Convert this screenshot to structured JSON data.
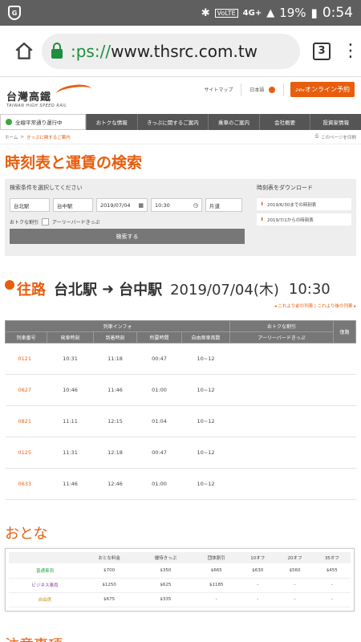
{
  "status_bar": {
    "shield_letter": "G",
    "signal": "4G+",
    "battery": "19%",
    "time": "0:54"
  },
  "browser": {
    "url_scheme": ":ps://",
    "url_rest": "www.thsrc.com.tw",
    "tab_count": "3"
  },
  "site": {
    "logo_main": "台灣高鐵",
    "logo_sub": "TAIWAN HIGH SPEED RAIL",
    "header_links": [
      "サイトマップ",
      "日本語"
    ],
    "online_badge": "24hr",
    "online_label": "オンライン予約",
    "status_label": "全線平常通り運行中",
    "nav": [
      "おトクな情報",
      "きっぷに関するご案内",
      "乗車のご案内",
      "会社概要",
      "投資家情報"
    ],
    "accent_color": "#e75e0e"
  },
  "breadcrumb": {
    "home": "ホーム",
    "separator": ">",
    "current": "きっぷに関するご案内",
    "print": "このページを印刷"
  },
  "page_title": "時刻表と運賃の検索",
  "search": {
    "label": "検索条件を選択してください",
    "from": "台北駅",
    "to": "台中駅",
    "date": "2019/07/04",
    "time": "10:30",
    "trip_type": "片道",
    "discount_label": "おトクな割引",
    "early_bird_label": "アーリーバードきっぷ",
    "search_button": "検索する",
    "download_label": "時刻表をダウンロード",
    "downloads": [
      "2019/6/30までの時刻表",
      "2019/7/1からの時刻表"
    ]
  },
  "route": {
    "type": "往路",
    "from": "台北駅",
    "to": "台中駅",
    "date": "2019/07/04(木)",
    "time": "10:30",
    "prev_link": "これより前の列車",
    "next_link": "これより後の列車",
    "sep": "|"
  },
  "train_table": {
    "group_headers": [
      "列車インフォ",
      "おトクな割引",
      "復路"
    ],
    "columns": [
      "列車番号",
      "発車時刻",
      "到着時刻",
      "所要時間",
      "自由席車両数",
      "アーリーバードきっぷ"
    ],
    "rows": [
      {
        "no": "0121",
        "dep": "10:31",
        "arr": "11:18",
        "dur": "00:47",
        "cars": "10~12"
      },
      {
        "no": "0627",
        "dep": "10:46",
        "arr": "11:46",
        "dur": "01:00",
        "cars": "10~12"
      },
      {
        "no": "0821",
        "dep": "11:11",
        "arr": "12:15",
        "dur": "01:04",
        "cars": "10~12"
      },
      {
        "no": "0125",
        "dep": "11:31",
        "arr": "12:18",
        "dur": "00:47",
        "cars": "10~12"
      },
      {
        "no": "0633",
        "dep": "11:46",
        "arr": "12:46",
        "dur": "01:00",
        "cars": "10~12"
      }
    ]
  },
  "fare": {
    "title": "おとな",
    "columns": [
      "",
      "おとな料金",
      "優待きっぷ",
      "団体割引",
      "10オフ",
      "20オフ",
      "35オフ"
    ],
    "rows": [
      {
        "cls": "普通車両",
        "color": "#2e9e4a",
        "vals": [
          "$700",
          "$350",
          "$665",
          "$630",
          "$560",
          "$455"
        ]
      },
      {
        "cls": "ビジネス車両",
        "color": "#8a3d9a",
        "vals": [
          "$1250",
          "$625",
          "$1185",
          "-",
          "-",
          "-"
        ]
      },
      {
        "cls": "自由席",
        "color": "#c8941a",
        "vals": [
          "$675",
          "$335",
          "-",
          "-",
          "-",
          "-"
        ]
      }
    ]
  },
  "notes": {
    "title": "注意事項"
  }
}
